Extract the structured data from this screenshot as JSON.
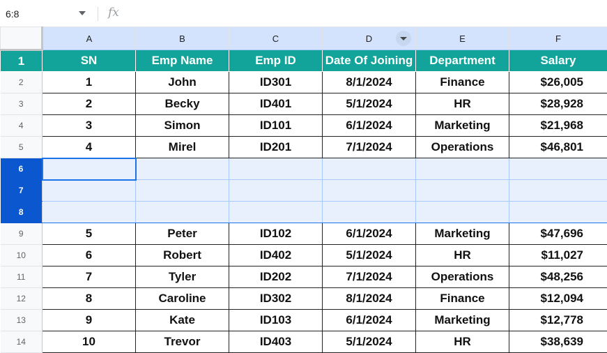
{
  "formula_bar": {
    "name_box": "6:8",
    "fx_label": "fx",
    "formula": ""
  },
  "columns": [
    "A",
    "B",
    "C",
    "D",
    "E",
    "F"
  ],
  "header": [
    "SN",
    "Emp Name",
    "Emp ID",
    "Date Of Joining",
    "Department",
    "Salary"
  ],
  "rows": [
    {
      "num": "1",
      "cells": null
    },
    {
      "num": "2",
      "cells": [
        "1",
        "John",
        "ID301",
        "8/1/2024",
        "Finance",
        "$26,005"
      ]
    },
    {
      "num": "3",
      "cells": [
        "2",
        "Becky",
        "ID401",
        "5/1/2024",
        "HR",
        "$28,928"
      ]
    },
    {
      "num": "4",
      "cells": [
        "3",
        "Simon",
        "ID101",
        "6/1/2024",
        "Marketing",
        "$21,968"
      ]
    },
    {
      "num": "5",
      "cells": [
        "4",
        "Mirel",
        "ID201",
        "7/1/2024",
        "Operations",
        "$46,801"
      ]
    },
    {
      "num": "6",
      "cells": [
        "",
        "",
        "",
        "",
        "",
        ""
      ]
    },
    {
      "num": "7",
      "cells": [
        "",
        "",
        "",
        "",
        "",
        ""
      ]
    },
    {
      "num": "8",
      "cells": [
        "",
        "",
        "",
        "",
        "",
        ""
      ]
    },
    {
      "num": "9",
      "cells": [
        "5",
        "Peter",
        "ID102",
        "6/1/2024",
        "Marketing",
        "$47,696"
      ]
    },
    {
      "num": "10",
      "cells": [
        "6",
        "Robert",
        "ID402",
        "5/1/2024",
        "HR",
        "$11,027"
      ]
    },
    {
      "num": "11",
      "cells": [
        "7",
        "Tyler",
        "ID202",
        "7/1/2024",
        "Operations",
        "$48,256"
      ]
    },
    {
      "num": "12",
      "cells": [
        "8",
        "Caroline",
        "ID302",
        "8/1/2024",
        "Finance",
        "$12,094"
      ]
    },
    {
      "num": "13",
      "cells": [
        "9",
        "Kate",
        "ID103",
        "6/1/2024",
        "Marketing",
        "$12,778"
      ]
    },
    {
      "num": "14",
      "cells": [
        "10",
        "Trevor",
        "ID403",
        "5/1/2024",
        "HR",
        "$38,639"
      ]
    }
  ],
  "colors": {
    "header_fill": "#12a39a",
    "selection": "#0b57d0",
    "selection_fill": "#e8f0fe"
  },
  "icons": {
    "name_box_dropdown": "chevron-down-icon",
    "filter": "filter-dropdown-icon",
    "fx": "function-icon"
  }
}
